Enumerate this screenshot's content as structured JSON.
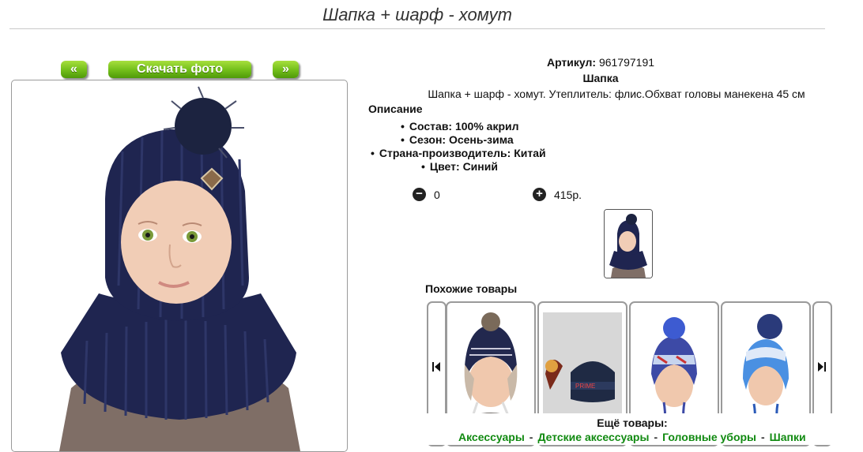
{
  "page": {
    "title": "Шапка + шарф - хомут"
  },
  "nav": {
    "prev_label": "«",
    "download_label": "Скачать фото",
    "next_label": "»"
  },
  "product": {
    "article_label": "Артикул:",
    "article_value": "961797191",
    "category": "Шапка",
    "description": "Шапка + шарф - хомут. Утеплитель: флис.Обхват головы манекена 45 см",
    "description_heading": "Описание",
    "specs": [
      "Состав: 100% акрил",
      "Сезон: Осень-зима",
      "Страна-производитель: Китай",
      "Цвет: Синий"
    ]
  },
  "cart": {
    "quantity": "0",
    "price": "415р.",
    "minus_icon": "minus-icon",
    "plus_icon": "plus-icon"
  },
  "similar": {
    "heading": "Похожие товары",
    "prev_icon": "skip-prev-icon",
    "next_icon": "skip-next-icon"
  },
  "more": {
    "heading": "Ещё товары:",
    "links": [
      "Аксессуары",
      "Детские аксессуары",
      "Головные уборы",
      "Шапки"
    ]
  },
  "colors": {
    "accent_green": "#76c11c",
    "link_green": "#118a11",
    "hat_navy": "#1f2550"
  }
}
